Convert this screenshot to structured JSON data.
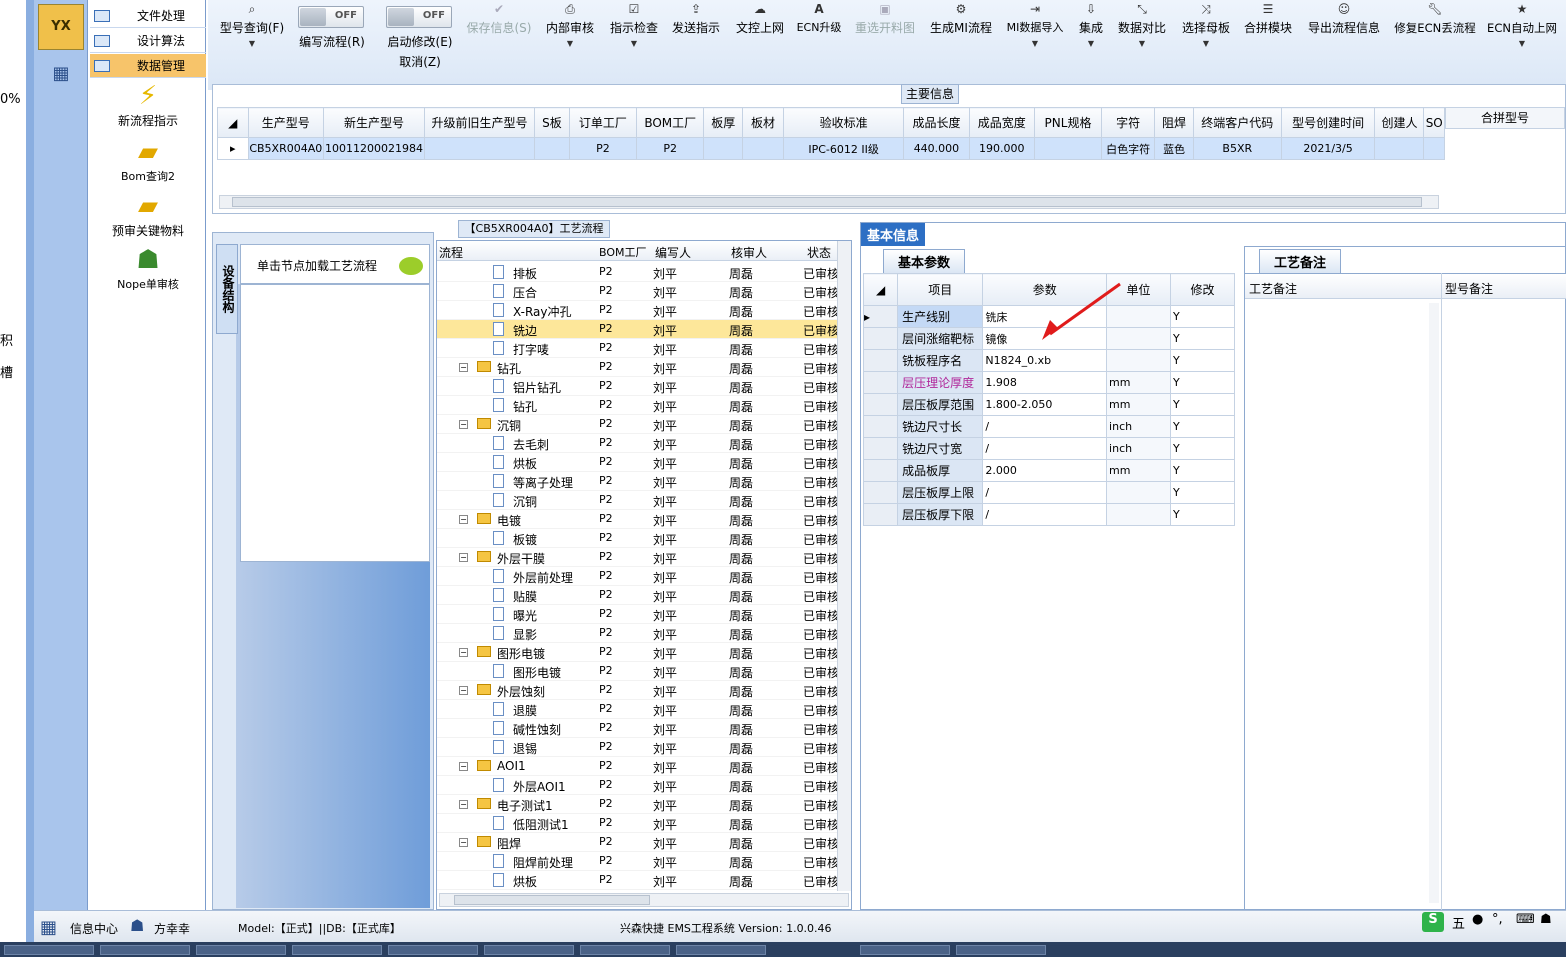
{
  "left_strip": {
    "texts": [
      "0%",
      "积",
      "槽"
    ]
  },
  "app_icon": {
    "label": "YX"
  },
  "nav": {
    "items": [
      {
        "label": "文件处理"
      },
      {
        "label": "设计算法"
      },
      {
        "label": "数据管理"
      }
    ],
    "tools": [
      {
        "label": "新流程指示"
      },
      {
        "label": "Bom查询2"
      },
      {
        "label": "预审关键物料"
      },
      {
        "label": "Nope单审核"
      }
    ]
  },
  "toolbar": {
    "items": [
      {
        "label": "型号查询(F)",
        "icon": "search-icon"
      },
      {
        "label": "编写流程(R)",
        "toggle": "OFF"
      },
      {
        "label": "启动修改(E)",
        "sub": "取消(Z)",
        "toggle": "OFF"
      },
      {
        "label": "保存信息(S)",
        "icon": "check-icon",
        "disabled": true
      },
      {
        "label": "内部审核",
        "icon": "print-icon"
      },
      {
        "label": "指示检查",
        "icon": "checklist-icon"
      },
      {
        "label": "发送指示",
        "icon": "upload-icon"
      },
      {
        "label": "文控上网",
        "icon": "cloud-upload-icon"
      },
      {
        "label": "ECN升级",
        "icon": "font-icon"
      },
      {
        "label": "重选开料图",
        "icon": "image-icon",
        "disabled": true
      },
      {
        "label": "生成MI流程",
        "icon": "cogs-icon"
      },
      {
        "label": "MI数据导入",
        "icon": "import-icon"
      },
      {
        "label": "集成",
        "icon": "download-icon"
      },
      {
        "label": "数据对比",
        "icon": "compress-icon"
      },
      {
        "label": "选择母板",
        "icon": "shuffle-icon"
      },
      {
        "label": "合拼模块",
        "icon": "list-icon"
      },
      {
        "label": "导出流程信息",
        "icon": "smile-icon"
      },
      {
        "label": "修复ECN丢流程",
        "icon": "wrench-icon"
      },
      {
        "label": "ECN自动上网",
        "icon": "star-icon"
      }
    ]
  },
  "main_info": {
    "group_title": "主要信息",
    "columns": [
      "生产型号",
      "新生产型号",
      "升级前旧生产型号",
      "S板",
      "订单工厂",
      "BOM工厂",
      "板厚",
      "板材",
      "验收标准",
      "成品长度",
      "成品宽度",
      "PNL规格",
      "字符",
      "阻焊",
      "终端客户代码",
      "型号创建时间",
      "创建人",
      "SO"
    ],
    "row": [
      "CB5XR004A0",
      "10011200021984",
      "",
      "",
      "P2",
      "P2",
      "",
      "",
      "IPC-6012 II级",
      "440.000",
      "190.000",
      "",
      "白色字符",
      "蓝色",
      "B5XR",
      "2021/3/5",
      "",
      ""
    ],
    "merge_header": "合拼型号"
  },
  "flow": {
    "title": "【CB5XR004A0】工艺流程",
    "side_tab": "设备结构",
    "hint": "单击节点加载工艺流程",
    "columns": [
      "流程",
      "BOM工厂",
      "编写人",
      "核审人",
      "状态"
    ],
    "rows": [
      {
        "name": "排板",
        "level": 2,
        "f": "P2",
        "w": "刘平",
        "r": "周磊",
        "s": "已审核"
      },
      {
        "name": "压合",
        "level": 2,
        "f": "P2",
        "w": "刘平",
        "r": "周磊",
        "s": "已审核"
      },
      {
        "name": "X-Ray冲孔",
        "level": 2,
        "f": "P2",
        "w": "刘平",
        "r": "周磊",
        "s": "已审核"
      },
      {
        "name": "铣边",
        "level": 2,
        "f": "P2",
        "w": "刘平",
        "r": "周磊",
        "s": "已审核",
        "selected": true
      },
      {
        "name": "打字唛",
        "level": 2,
        "f": "P2",
        "w": "刘平",
        "r": "周磊",
        "s": "已审核"
      },
      {
        "name": "钻孔",
        "level": 1,
        "f": "P2",
        "w": "刘平",
        "r": "周磊",
        "s": "已审核"
      },
      {
        "name": "铝片钻孔",
        "level": 2,
        "f": "P2",
        "w": "刘平",
        "r": "周磊",
        "s": "已审核"
      },
      {
        "name": "钻孔",
        "level": 2,
        "f": "P2",
        "w": "刘平",
        "r": "周磊",
        "s": "已审核"
      },
      {
        "name": "沉铜",
        "level": 1,
        "f": "P2",
        "w": "刘平",
        "r": "周磊",
        "s": "已审核"
      },
      {
        "name": "去毛刺",
        "level": 2,
        "f": "P2",
        "w": "刘平",
        "r": "周磊",
        "s": "已审核"
      },
      {
        "name": "烘板",
        "level": 2,
        "f": "P2",
        "w": "刘平",
        "r": "周磊",
        "s": "已审核"
      },
      {
        "name": "等离子处理",
        "level": 2,
        "f": "P2",
        "w": "刘平",
        "r": "周磊",
        "s": "已审核"
      },
      {
        "name": "沉铜",
        "level": 2,
        "f": "P2",
        "w": "刘平",
        "r": "周磊",
        "s": "已审核"
      },
      {
        "name": "电镀",
        "level": 1,
        "f": "P2",
        "w": "刘平",
        "r": "周磊",
        "s": "已审核"
      },
      {
        "name": "板镀",
        "level": 2,
        "f": "P2",
        "w": "刘平",
        "r": "周磊",
        "s": "已审核"
      },
      {
        "name": "外层干膜",
        "level": 1,
        "f": "P2",
        "w": "刘平",
        "r": "周磊",
        "s": "已审核"
      },
      {
        "name": "外层前处理",
        "level": 2,
        "f": "P2",
        "w": "刘平",
        "r": "周磊",
        "s": "已审核"
      },
      {
        "name": "贴膜",
        "level": 2,
        "f": "P2",
        "w": "刘平",
        "r": "周磊",
        "s": "已审核"
      },
      {
        "name": "曝光",
        "level": 2,
        "f": "P2",
        "w": "刘平",
        "r": "周磊",
        "s": "已审核"
      },
      {
        "name": "显影",
        "level": 2,
        "f": "P2",
        "w": "刘平",
        "r": "周磊",
        "s": "已审核"
      },
      {
        "name": "图形电镀",
        "level": 1,
        "f": "P2",
        "w": "刘平",
        "r": "周磊",
        "s": "已审核"
      },
      {
        "name": "图形电镀",
        "level": 2,
        "f": "P2",
        "w": "刘平",
        "r": "周磊",
        "s": "已审核"
      },
      {
        "name": "外层蚀刻",
        "level": 1,
        "f": "P2",
        "w": "刘平",
        "r": "周磊",
        "s": "已审核"
      },
      {
        "name": "退膜",
        "level": 2,
        "f": "P2",
        "w": "刘平",
        "r": "周磊",
        "s": "已审核"
      },
      {
        "name": "碱性蚀刻",
        "level": 2,
        "f": "P2",
        "w": "刘平",
        "r": "周磊",
        "s": "已审核"
      },
      {
        "name": "退锡",
        "level": 2,
        "f": "P2",
        "w": "刘平",
        "r": "周磊",
        "s": "已审核"
      },
      {
        "name": "AOI1",
        "level": 1,
        "f": "P2",
        "w": "刘平",
        "r": "周磊",
        "s": "已审核"
      },
      {
        "name": "外层AOI1",
        "level": 2,
        "f": "P2",
        "w": "刘平",
        "r": "周磊",
        "s": "已审核"
      },
      {
        "name": "电子测试1",
        "level": 1,
        "f": "P2",
        "w": "刘平",
        "r": "周磊",
        "s": "已审核"
      },
      {
        "name": "低阻测试1",
        "level": 2,
        "f": "P2",
        "w": "刘平",
        "r": "周磊",
        "s": "已审核"
      },
      {
        "name": "阻焊",
        "level": 1,
        "f": "P2",
        "w": "刘平",
        "r": "周磊",
        "s": "已审核"
      },
      {
        "name": "阻焊前处理",
        "level": 2,
        "f": "P2",
        "w": "刘平",
        "r": "周磊",
        "s": "已审核"
      },
      {
        "name": "烘板",
        "level": 2,
        "f": "P2",
        "w": "刘平",
        "r": "周磊",
        "s": "已审核"
      }
    ]
  },
  "basic": {
    "tab": "基本信息",
    "subtab": "基本参数",
    "columns": [
      "项目",
      "参数",
      "单位",
      "修改"
    ],
    "rows": [
      {
        "item": "生产线别",
        "param": "铣床",
        "unit": "",
        "mod": "Y"
      },
      {
        "item": "层间涨缩靶标",
        "param": "镜像",
        "unit": "",
        "mod": "Y"
      },
      {
        "item": "铣板程序名",
        "param": "N1824_0.xb",
        "unit": "",
        "mod": "Y"
      },
      {
        "item": "层压理论厚度",
        "param": "1.908",
        "unit": "mm",
        "mod": "Y",
        "highlight": true
      },
      {
        "item": "层压板厚范围",
        "param": "1.800-2.050",
        "unit": "mm",
        "mod": "Y"
      },
      {
        "item": "铣边尺寸长",
        "param": "/",
        "unit": "inch",
        "mod": "Y"
      },
      {
        "item": "铣边尺寸宽",
        "param": "/",
        "unit": "inch",
        "mod": "Y"
      },
      {
        "item": "成品板厚",
        "param": "2.000",
        "unit": "mm",
        "mod": "Y"
      },
      {
        "item": "层压板厚上限",
        "param": "/",
        "unit": "",
        "mod": "Y"
      },
      {
        "item": "层压板厚下限",
        "param": "/",
        "unit": "",
        "mod": "Y"
      }
    ]
  },
  "notes": {
    "tab": "工艺备注",
    "col1": "工艺备注",
    "col2": "型号备注"
  },
  "status": {
    "info_center": "信息中心",
    "user": "方幸幸",
    "model": "Model:【正式】||DB:【正式库】",
    "app": "兴森快捷  EMS工程系统  Version: 1.0.0.46"
  },
  "ime": {
    "label": "五"
  },
  "colors": {
    "accent": "#2d6fc4",
    "selected_nav": "#f7c46a",
    "selected_row": "#fde79a",
    "highlight_text": "#b0279a",
    "arrow": "#e01b1b"
  }
}
